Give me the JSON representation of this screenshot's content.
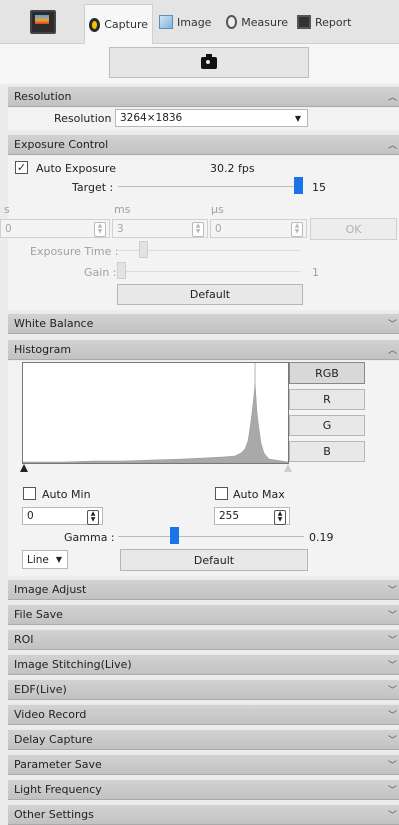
{
  "tabs": [
    {
      "label": "Capture",
      "icon": "capture-icon"
    },
    {
      "label": "Image",
      "icon": "image-icon"
    },
    {
      "label": "Measure",
      "icon": "measure-icon"
    },
    {
      "label": "Report",
      "icon": "report-icon"
    }
  ],
  "resolution": {
    "title": "Resolution",
    "label": "Resolution :",
    "value": "3264×1836"
  },
  "exposure": {
    "title": "Exposure Control",
    "auto_label": "Auto Exposure",
    "auto_checked": true,
    "fps": "30.2 fps",
    "target_label": "Target :",
    "target_value": "15",
    "unit_s": "s",
    "unit_ms": "ms",
    "unit_us": "µs",
    "s_value": "0",
    "ms_value": "3",
    "us_value": "0",
    "ok_label": "OK",
    "exposure_time_label": "Exposure Time :",
    "gain_label": "Gain :",
    "gain_value": "1",
    "default_label": "Default"
  },
  "white_balance": {
    "title": "White Balance"
  },
  "histogram": {
    "title": "Histogram",
    "channels": [
      "RGB",
      "R",
      "G",
      "B"
    ],
    "auto_min_label": "Auto Min",
    "auto_max_label": "Auto Max",
    "min_value": "0",
    "max_value": "255",
    "gamma_label": "Gamma :",
    "gamma_value": "0.19",
    "mode_value": "Line",
    "default_label": "Default"
  },
  "sections": [
    "Image Adjust",
    "File Save",
    "ROI",
    "Image Stitching(Live)",
    "EDF(Live)",
    "Video Record",
    "Delay Capture",
    "Parameter Save",
    "Light Frequency",
    "Other Settings"
  ]
}
